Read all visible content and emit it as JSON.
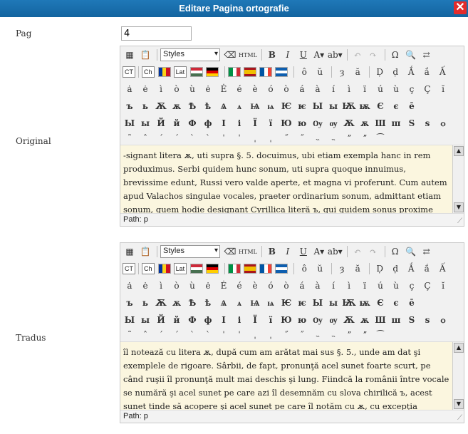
{
  "window": {
    "title": "Editare Pagina ortografie",
    "close": "✕"
  },
  "form": {
    "pag_label": "Pag",
    "pag_value": "4",
    "original_label": "Original",
    "tradus_label": "Tradus"
  },
  "toolbar": {
    "styles": "Styles",
    "bold": "B",
    "italic": "I",
    "underline": "U",
    "html": "HTML",
    "omega": "Ω",
    "ct": "CT",
    "ch": "Ch",
    "lat": "Lat",
    "row3": [
      "ô",
      "ŭ",
      "ȝ",
      "ă",
      "Ḍ",
      "ḍ",
      "Ắ",
      "ắ",
      "Ấ"
    ],
    "row4": [
      "ȧ",
      "ė",
      "ì",
      "ò",
      "ù",
      "ė",
      "Ė",
      "é",
      "è",
      "ó",
      "ò",
      "á",
      "à",
      "í",
      "ì",
      "ï",
      "ú",
      "ù",
      "ç",
      "Ç",
      "ĭ"
    ],
    "row5": [
      "ъ",
      "ь",
      "Ѫ",
      "ѫ",
      "Ѣ",
      "ѣ",
      "Ѧ",
      "ѧ",
      "Ѩ",
      "ѩ",
      "Ѥ",
      "ѥ",
      "Ы",
      "ы",
      "Ѭ",
      "ѭ",
      "Є",
      "є",
      "ē"
    ],
    "row6": [
      "Ы",
      "ы",
      "Й",
      "й",
      "Ф",
      "ф",
      "І",
      "і",
      "Ї",
      "ї",
      "Ю",
      "ю",
      "Ѹ",
      "ѹ",
      "Ѫ",
      "ѫ",
      "Ш",
      "ш",
      "Ѕ",
      "ѕ",
      "ѻ"
    ],
    "row7": [
      "˜",
      "ˆ",
      "ˊ",
      "ˊ",
      "ˋ",
      "ˋ",
      "ˈ",
      "ˈ",
      "ˌ",
      "ˌ",
      "˝",
      "˝",
      "˵",
      "˵",
      "ˮ",
      "ˮ",
      "⁀"
    ]
  },
  "editor_original": {
    "text": "-signant litera ѫ, uti supra §. 5. docuimus, ubi etiam exempla hanc in rem produximus. Serbi quidem hunc sonum, uti supra quoque innuimus, brevissime edunt, Russi vero valde aperte, et magna vi proferunt. Cum autem apud Valachos singulae vocales, praeter ordinarium sonum, admittant etiam sonum, quem hodie designant Cyrillica literă ъ, qui quidem sonus proxime accedit ad sonum, quem hodie",
    "path": "Path: p"
  },
  "editor_tradus": {
    "text": "îl notează cu litera ѫ, după cum am arătat mai sus §. 5., unde am dat şi exemplele de rigoare. Sârbii, de fapt, pronunţă acel sunet foarte scurt, pe când ruşii îl pronunţă mult mai deschis şi lung. Fiindcă la românii între vocale se numără şi acel sunet pe care azi îl desemnăm cu slova chirilică ъ, acest sunet tinde să acopere şi acel sunet pe care îl notăm cu ѫ, cu excepţia situaţiilor în care ѫ a ajuns să se nazalizeze; din",
    "path": "Path: p"
  }
}
